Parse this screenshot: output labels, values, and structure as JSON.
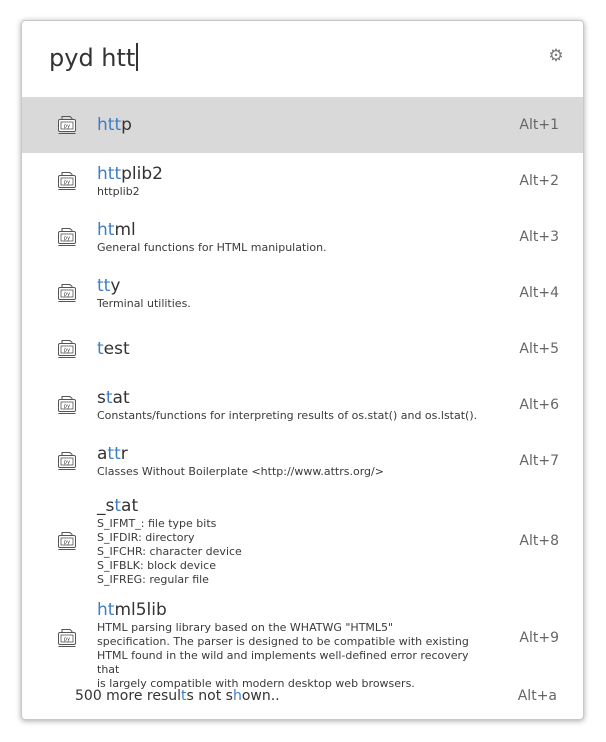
{
  "search": {
    "query": "pyd htt"
  },
  "settings_icon": "gear-icon",
  "result_icon": "python-file-icon",
  "results": [
    {
      "title_hl": "htt",
      "title_rest": "p",
      "description": "",
      "shortcut": "Alt+1",
      "selected": true
    },
    {
      "title_hl": "htt",
      "title_rest": "plib2",
      "description": "httplib2",
      "shortcut": "Alt+2"
    },
    {
      "title_hl": "ht",
      "title_mid": "",
      "title_hl2": "",
      "title_rest": "ml",
      "description": "General functions for HTML manipulation.",
      "shortcut": "Alt+3"
    },
    {
      "title_hl": "tt",
      "title_rest": "y",
      "description": "Terminal utilities.",
      "shortcut": "Alt+4"
    },
    {
      "title_hl": "t",
      "title_rest": "est",
      "description": "",
      "shortcut": "Alt+5"
    },
    {
      "title_pre": "s",
      "title_hl": "t",
      "title_rest": "at",
      "description": "Constants/functions for interpreting results of os.stat() and os.lstat().",
      "shortcut": "Alt+6"
    },
    {
      "title_pre": "a",
      "title_hl": "tt",
      "title_rest": "r",
      "description": "Classes Without Boilerplate <http://www.attrs.org/>",
      "shortcut": "Alt+7"
    },
    {
      "title_pre": "_s",
      "title_hl": "t",
      "title_rest": "at",
      "description": "S_IFMT_: file type bits\nS_IFDIR: directory\nS_IFCHR: character device\nS_IFBLK: block device\nS_IFREG: regular file",
      "shortcut": "Alt+8"
    },
    {
      "title_hl": "ht",
      "title_rest": "ml5lib",
      "description": "HTML parsing library based on the WHATWG \"HTML5\"\nspecification. The parser is designed to be compatible with existing\nHTML found in the wild and implements well-defined error recovery that\nis largely compatible with modern desktop web browsers.",
      "shortcut": "Alt+9"
    }
  ],
  "footer": {
    "text_a": "500 more resul",
    "text_hl1": "t",
    "text_b": "s not s",
    "text_hl2": "h",
    "text_c": "own..",
    "shortcut": "Alt+a"
  },
  "colors": {
    "highlight": "#3d7fc5",
    "selected_row": "#d9d9d9"
  }
}
